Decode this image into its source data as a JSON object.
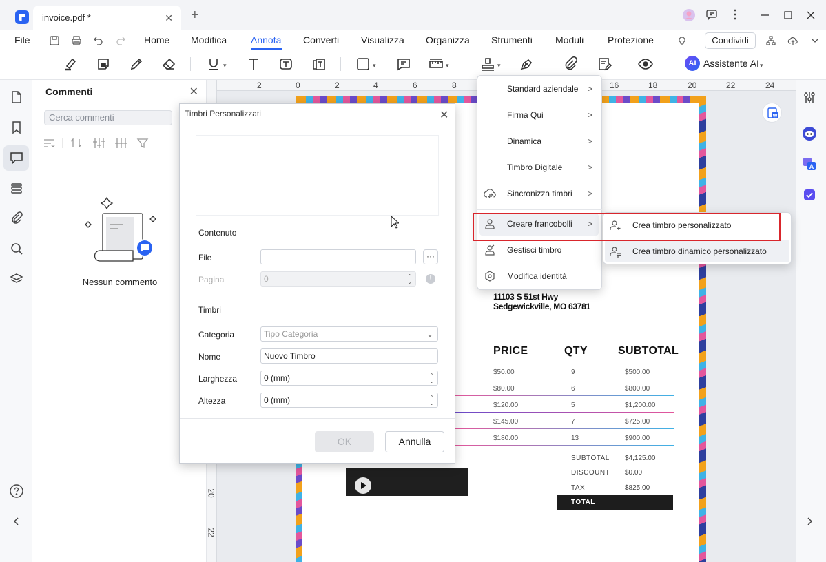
{
  "titlebar": {
    "tab_title": "invoice.pdf *",
    "tab_close": "✕",
    "new_tab": "+"
  },
  "menubar": {
    "file": "File",
    "items": [
      "Home",
      "Modifica",
      "Annota",
      "Converti",
      "Visualizza",
      "Organizza",
      "Strumenti",
      "Moduli",
      "Protezione"
    ],
    "active": "Annota",
    "share": "Condividi"
  },
  "toolbar": {
    "ai_badge": "AI",
    "ai_label": "Assistente AI"
  },
  "comments_panel": {
    "title": "Commenti",
    "close": "✕",
    "search_placeholder": "Cerca commenti",
    "empty_text": "Nessun commento"
  },
  "ruler": {
    "h_ticks": [
      "2",
      "0",
      "2",
      "4",
      "6",
      "8",
      "16",
      "18",
      "20",
      "22",
      "24"
    ],
    "v_ticks": [
      "20",
      "22"
    ]
  },
  "dialog": {
    "title": "Timbri Personalizzati",
    "close": "✕",
    "section_content": "Contenuto",
    "file_label": "File",
    "file_value": "",
    "browse": "···",
    "page_label": "Pagina",
    "page_value": "0",
    "section_stamps": "Timbri",
    "category_label": "Categoria",
    "category_placeholder": "Tipo Categoria",
    "name_label": "Nome",
    "name_value": "Nuovo Timbro",
    "width_label": "Larghezza",
    "width_value": "0 (mm)",
    "height_label": "Altezza",
    "height_value": "0 (mm)",
    "ok": "OK",
    "cancel": "Annulla"
  },
  "stamp_menu": {
    "items": [
      "Standard aziendale",
      "Firma Qui",
      "Dinamica",
      "Timbro Digitale",
      "Sincronizza timbri",
      "Creare francobolli",
      "Gestisci timbro",
      "Modifica identità"
    ],
    "arrow": ">",
    "submenu": [
      "Crea timbro personalizzato",
      "Crea timbro dinamico personalizzato"
    ]
  },
  "invoice": {
    "address_line1": "11103 S 51st Hwy",
    "address_line2": "Sedgewickville, MO 63781",
    "headers": [
      "PRICE",
      "QTY",
      "SUBTOTAL"
    ],
    "rows": [
      {
        "price": "$50.00",
        "qty": "9",
        "subtotal": "$500.00"
      },
      {
        "price": "$80.00",
        "qty": "6",
        "subtotal": "$800.00"
      },
      {
        "price": "$120.00",
        "qty": "5",
        "subtotal": "$1,200.00"
      },
      {
        "price": "$145.00",
        "qty": "7",
        "subtotal": "$725.00"
      },
      {
        "price": "$180.00",
        "qty": "13",
        "subtotal": "$900.00"
      }
    ],
    "summary": [
      {
        "label": "SUBTOTAL",
        "value": "$4,125.00"
      },
      {
        "label": "DISCOUNT",
        "value": "$0.00"
      },
      {
        "label": "TAX",
        "value": "$825.00"
      }
    ],
    "total_label": "TOTAL"
  },
  "colors": {
    "accent": "#2a63f2",
    "highlight": "#d9262c"
  }
}
